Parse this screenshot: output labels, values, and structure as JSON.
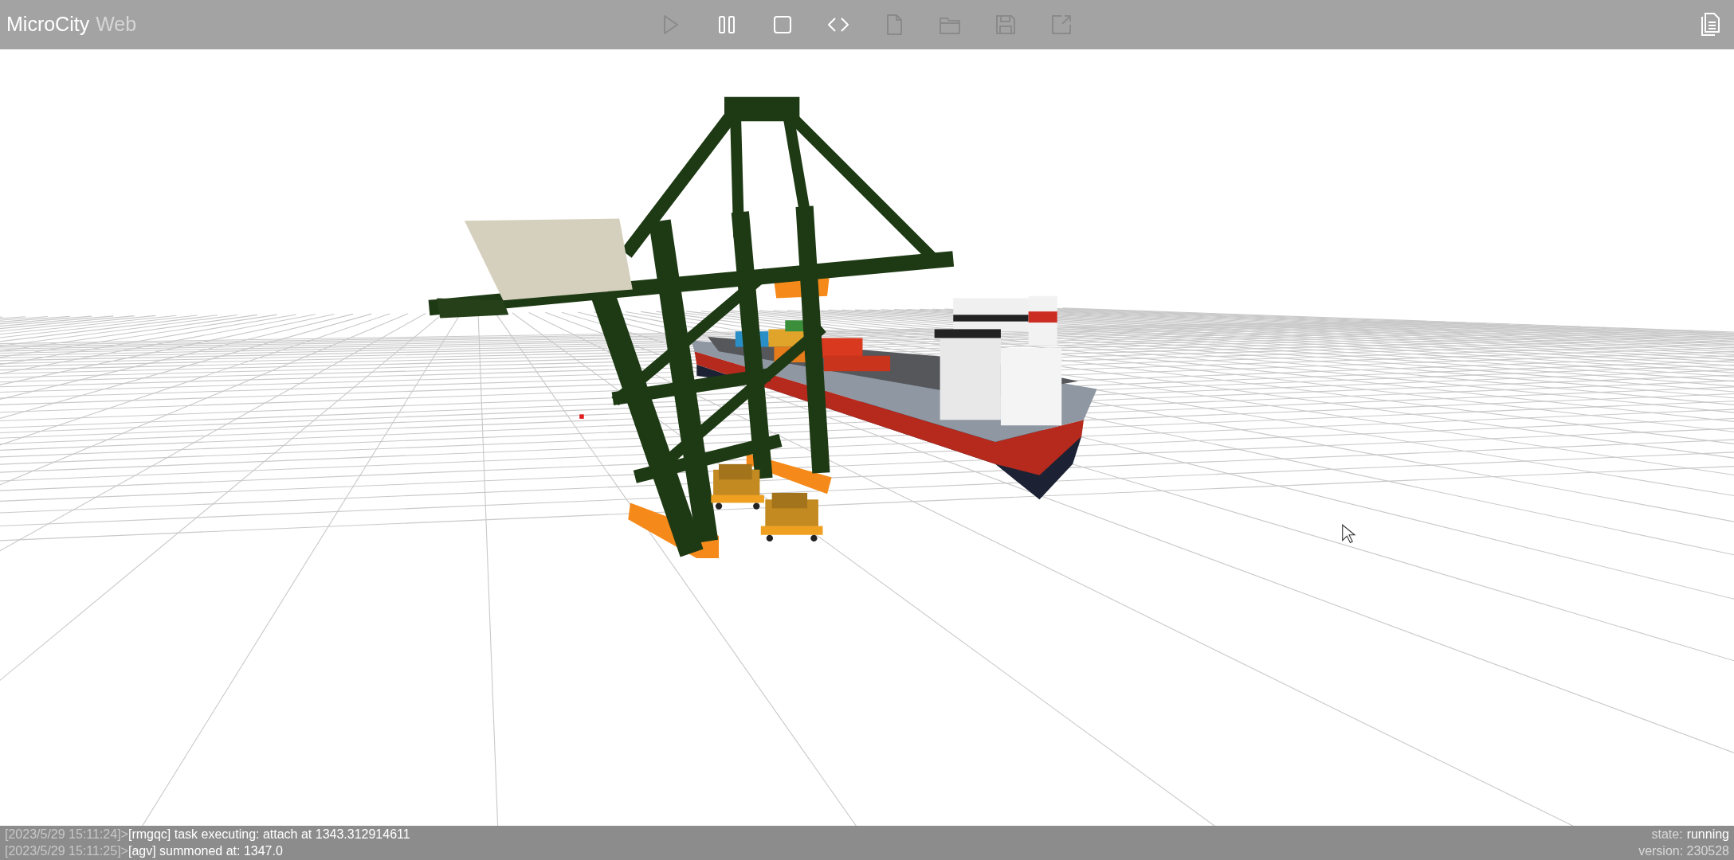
{
  "app": {
    "title": "MicroCity",
    "subtitle": "Web"
  },
  "toolbar": [
    {
      "kind": "play",
      "disabled": true
    },
    {
      "kind": "pause",
      "disabled": false
    },
    {
      "kind": "stop",
      "disabled": false
    },
    {
      "kind": "code",
      "disabled": false
    },
    {
      "kind": "new",
      "disabled": true
    },
    {
      "kind": "open",
      "disabled": true
    },
    {
      "kind": "save",
      "disabled": true
    },
    {
      "kind": "export",
      "disabled": true
    }
  ],
  "log": [
    {
      "timestamp": "[2023/5/29 15:11:24]>",
      "message": "[rmgqc] task executing: attach at 1343.312914611"
    },
    {
      "timestamp": "[2023/5/29 15:11:25]>",
      "message": "[agv] summoned at: 1347.0"
    }
  ],
  "status": {
    "state_label": "state:",
    "state": "running",
    "version": "version: 230528"
  }
}
